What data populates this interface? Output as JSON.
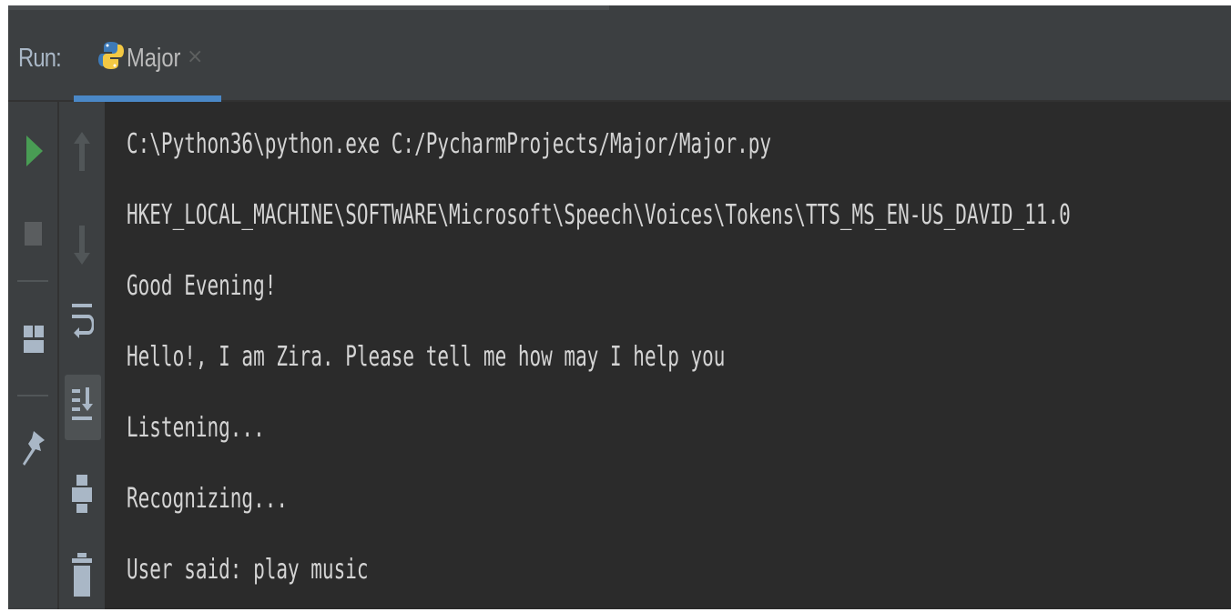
{
  "run_panel": {
    "label": "Run:",
    "tab": {
      "label": "Major",
      "icon": "python-icon",
      "close_glyph": "×"
    }
  },
  "toolbar": {
    "left_icons": [
      "run-icon",
      "stop-icon",
      "layout-icon",
      "pin-icon"
    ],
    "right_icons": [
      "arrow-up-icon",
      "arrow-down-icon",
      "soft-wrap-icon",
      "scroll-to-end-icon",
      "print-icon",
      "trash-icon"
    ]
  },
  "console": {
    "lines": [
      "C:\\Python36\\python.exe C:/PycharmProjects/Major/Major.py",
      "HKEY_LOCAL_MACHINE\\SOFTWARE\\Microsoft\\Speech\\Voices\\Tokens\\TTS_MS_EN-US_DAVID_11.0",
      "Good Evening!",
      "Hello!, I am Zira. Please tell me how may I help you",
      "Listening...",
      "Recognizing...",
      "User said: play music"
    ]
  },
  "colors": {
    "background": "#2b2b2b",
    "panel": "#3c3f41",
    "accent": "#4a88c7",
    "run_green": "#499c54",
    "text": "#d4d4d4"
  }
}
